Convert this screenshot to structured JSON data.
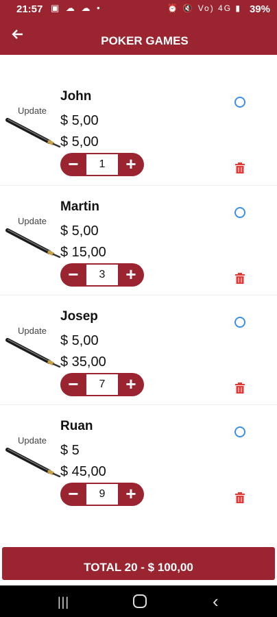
{
  "status": {
    "time": "21:57",
    "battery": "39%",
    "left_icons": "▣ ☁ ☁ •",
    "right_icons": "⏰ 🔇 Vo) 4G ▮"
  },
  "header": {
    "title": "POKER GAMES"
  },
  "items": [
    {
      "name": "John",
      "unit_price": "$ 5,00",
      "line_total": "$ 5,00",
      "quantity": "1",
      "update_label": "Update"
    },
    {
      "name": "Martin",
      "unit_price": "$ 5,00",
      "line_total": "$ 15,00",
      "quantity": "3",
      "update_label": "Update"
    },
    {
      "name": "Josep",
      "unit_price": "$ 5,00",
      "line_total": "$ 35,00",
      "quantity": "7",
      "update_label": "Update"
    },
    {
      "name": "Ruan",
      "unit_price": "$ 5",
      "line_total": "$ 45,00",
      "quantity": "9",
      "update_label": "Update"
    }
  ],
  "stepper": {
    "minus": "−",
    "plus": "+"
  },
  "total": {
    "label": "TOTAL 20 - $ 100,00"
  },
  "colors": {
    "primary": "#9a2530",
    "radio": "#3b8ee6",
    "trash": "#e53935"
  },
  "icons": {
    "back": "arrow-left-icon",
    "pen": "pen-icon",
    "radio": "radio-button-icon",
    "trash": "trash-icon"
  }
}
